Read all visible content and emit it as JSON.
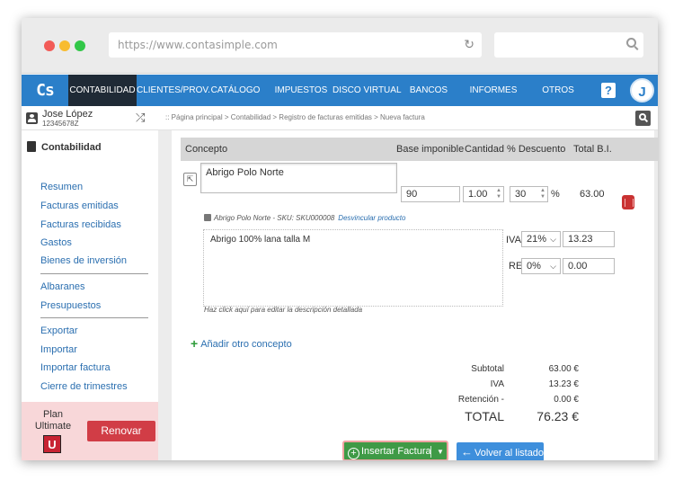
{
  "browser": {
    "url": "https://www.contasimple.com"
  },
  "nav": {
    "logo": "Cs",
    "items": [
      "CONTABILIDAD",
      "CLIENTES/PROV.",
      "CATÁLOGO",
      "IMPUESTOS",
      "DISCO VIRTUAL",
      "BANCOS",
      "INFORMES",
      "OTROS"
    ],
    "help_label": "?",
    "avatar_initial": "J"
  },
  "user": {
    "name": "Jose López",
    "id": "12345678Z"
  },
  "breadcrumb": ":: Página principal > Contabilidad > Registro de facturas emitidas > Nueva factura",
  "sidebar": {
    "heading": "Contabilidad",
    "group1": [
      "Resumen",
      "Facturas emitidas",
      "Facturas recibidas",
      "Gastos",
      "Bienes de inversión"
    ],
    "group2": [
      "Albaranes",
      "Presupuestos"
    ],
    "group3": [
      "Exportar",
      "Importar",
      "Importar factura",
      "Cierre de trimestres"
    ]
  },
  "plan": {
    "label_top": "Plan",
    "label_name": "Ultimate",
    "badge": "U",
    "renew_label": "Renovar"
  },
  "table": {
    "headers": [
      "Concepto",
      "Base imponible",
      "Cantidad",
      "% Descuento",
      "Total B.I."
    ],
    "row": {
      "concept": "Abrigo Polo Norte",
      "base": "90",
      "quantity": "1.00",
      "discount": "30",
      "discount_suffix": "%",
      "total": "63.00",
      "sku_text": "Abrigo Polo Norte - SKU: SKU000008",
      "unlink_label": "Desvincular producto",
      "description": "Abrigo 100% lana talla M",
      "description_hint": "Haz click aquí para editar la descripción detallada",
      "iva_label": "IVA",
      "iva_rate": "21%",
      "iva_amount": "13.23",
      "re_label": "RE",
      "re_rate": "0%",
      "re_amount": "0.00"
    }
  },
  "add_concept_label": "Añadir otro concepto",
  "summary": {
    "subtotal_label": "Subtotal",
    "subtotal_value": "63.00 €",
    "iva_label": "IVA",
    "iva_value": "13.23 €",
    "retention_label": "Retención -",
    "retention_value": "0.00 €",
    "total_label": "TOTAL",
    "total_value": "76.23 €"
  },
  "actions": {
    "insert_label": "Insertar Factura",
    "back_label": "Volver al listado"
  },
  "colors": {
    "nav": "#2b7fc9",
    "nav_active": "#1f2a36",
    "insert": "#3f9a46",
    "back": "#3e8fdc",
    "renew": "#d13d46"
  }
}
